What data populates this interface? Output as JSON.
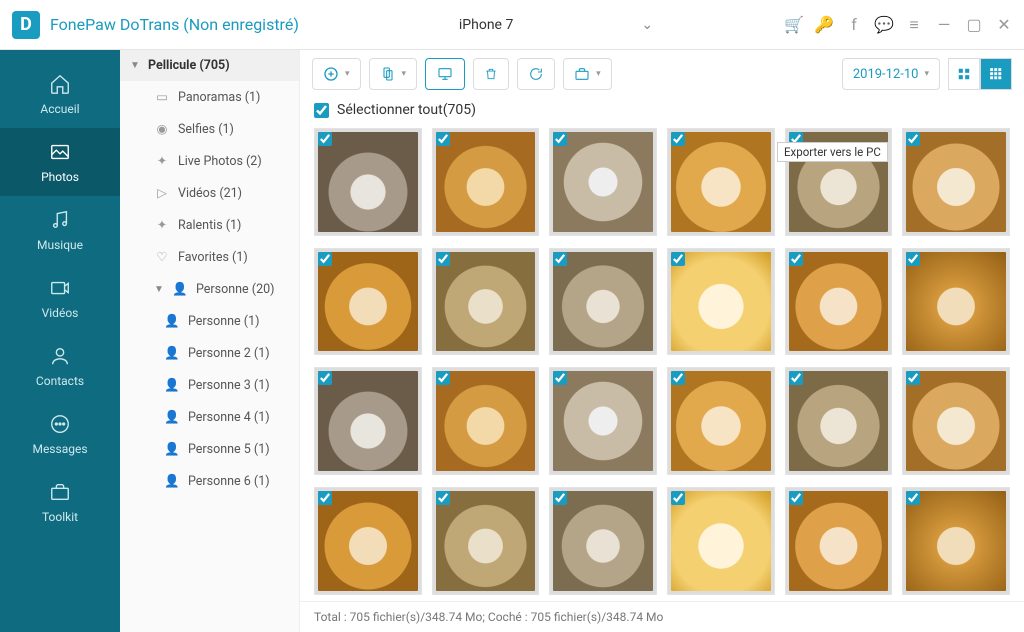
{
  "title": "FonePaw DoTrans (Non enregistré)",
  "device": "iPhone 7",
  "nav": {
    "home": "Accueil",
    "photos": "Photos",
    "music": "Musique",
    "videos": "Vidéos",
    "contacts": "Contacts",
    "messages": "Messages",
    "toolkit": "Toolkit"
  },
  "tree": {
    "root": "Pellicule (705)",
    "items": [
      {
        "label": "Panoramas (1)"
      },
      {
        "label": "Selfies (1)"
      },
      {
        "label": "Live Photos (2)"
      },
      {
        "label": "Vidéos (21)"
      },
      {
        "label": "Ralentis (1)"
      },
      {
        "label": "Favorites (1)"
      }
    ],
    "person_header": "Personne (20)",
    "persons": [
      {
        "label": "Personne (1)"
      },
      {
        "label": "Personne 2 (1)"
      },
      {
        "label": "Personne 3 (1)"
      },
      {
        "label": "Personne 4 (1)"
      },
      {
        "label": "Personne 5 (1)"
      },
      {
        "label": "Personne 6 (1)"
      }
    ]
  },
  "toolbar": {
    "tooltip": "Exporter vers le PC",
    "date": "2019-12-10"
  },
  "selectall": "Sélectionner tout(705)",
  "footer": "Total : 705 fichier(s)/348.74 Mo; Coché : 705 fichier(s)/348.74 Mo",
  "thumbs_count": 24
}
